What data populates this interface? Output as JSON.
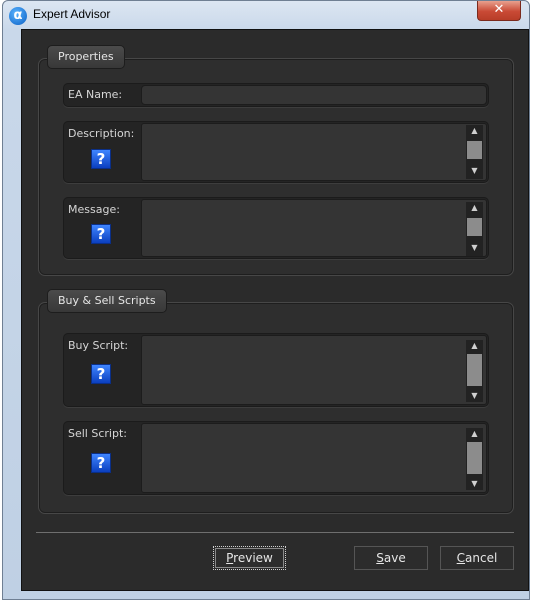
{
  "window": {
    "title": "Expert Advisor",
    "close_label": "✕"
  },
  "properties": {
    "group_label": "Properties",
    "ea_name_label": "EA Name:",
    "description_label": "Description:",
    "message_label": "Message:"
  },
  "scripts": {
    "group_label": "Buy & Sell Scripts",
    "buy_label": "Buy Script:",
    "sell_label": "Sell Script:"
  },
  "help_glyph": "?",
  "buttons": {
    "preview": {
      "accel": "P",
      "rest": "review"
    },
    "save": {
      "accel": "S",
      "rest": "ave"
    },
    "cancel": {
      "accel": "C",
      "rest": "ancel"
    }
  },
  "icons": {
    "app": "alpha-icon",
    "help": "question-help-icon"
  }
}
